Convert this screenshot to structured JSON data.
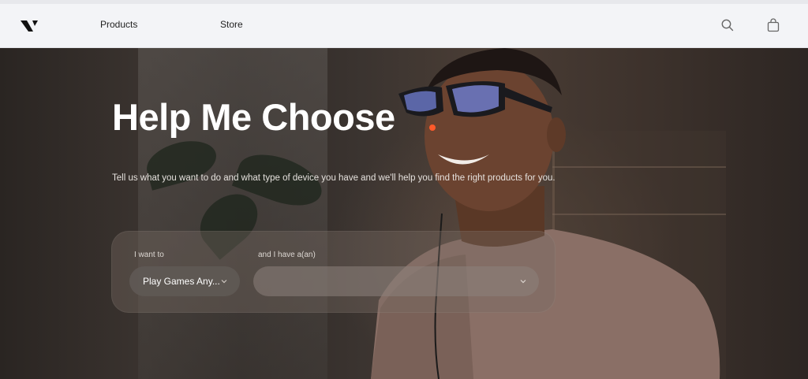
{
  "nav": {
    "products_label": "Products",
    "store_label": "Store",
    "logo_icon": "brand-logo-icon",
    "search_icon": "search-icon",
    "cart_icon": "shopping-bag-icon"
  },
  "hero": {
    "title": "Help Me Choose",
    "subtitle": "Tell us what you want to do and what type of device you have and we'll help you find the right products for you."
  },
  "chooser": {
    "want_label": "I want to",
    "want_value": "Play Games Any...",
    "have_label": "and I have a(an)",
    "have_value": ""
  },
  "colors": {
    "accent_dot": "#ff5a2a",
    "nav_bg": "#f3f4f7"
  }
}
